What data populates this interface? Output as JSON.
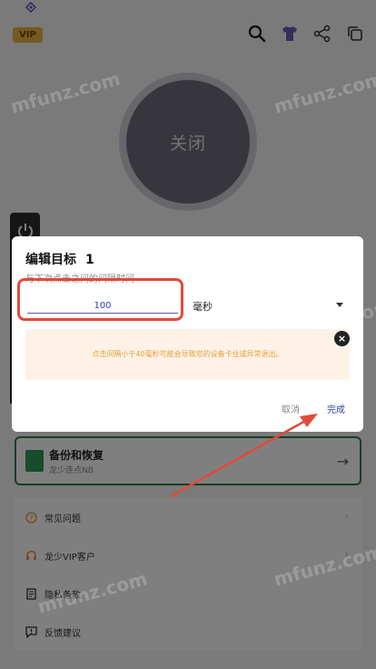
{
  "header": {
    "vip_label": "VIP"
  },
  "main": {
    "toggle_label": "关闭"
  },
  "backup": {
    "title": "备份和恢复",
    "subtitle": "龙少连点NB"
  },
  "list": {
    "items": [
      {
        "label": "常见问题"
      },
      {
        "label": "龙少VIP客户"
      },
      {
        "label": "隐私条款"
      },
      {
        "label": "反馈建议"
      }
    ]
  },
  "dialog": {
    "title": "编辑目标",
    "target_number": "1",
    "subtitle": "与下次点击之间的间隔时间",
    "input_value": "100",
    "unit": "毫秒",
    "warning": "点击间隔小于40毫秒可能会导致您的设备卡住或异常退出。",
    "cancel_label": "取消",
    "done_label": "完成"
  },
  "watermark": "mfunz.com",
  "colors": {
    "accent": "#2b3fa8",
    "warning_text": "#e4a23c",
    "warning_bg": "#fdf2e5",
    "highlight": "#e14a3a",
    "backup_green": "#2f7f4a",
    "vip_gold": "#e8b343"
  }
}
